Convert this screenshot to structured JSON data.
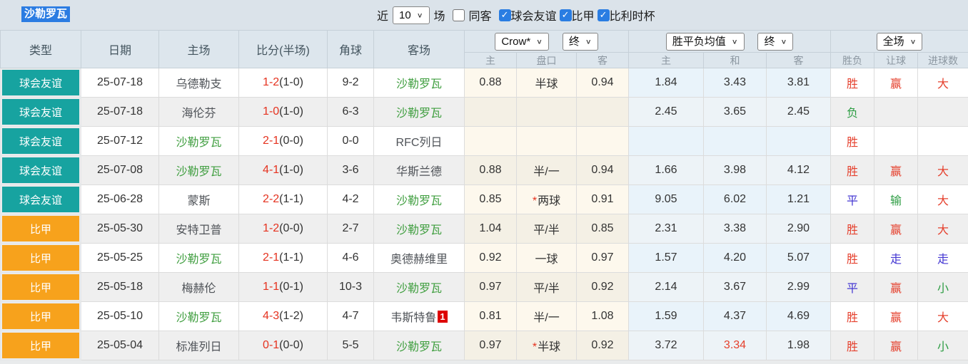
{
  "team_title": "沙勒罗瓦",
  "toolbar": {
    "recent_label": "近",
    "recent_count": "10",
    "matches_label": "场",
    "same_away": {
      "label": "同客",
      "checked": false
    },
    "filters": [
      {
        "label": "球会友谊",
        "checked": true
      },
      {
        "label": "比甲",
        "checked": true
      },
      {
        "label": "比利时杯",
        "checked": true
      }
    ]
  },
  "header": {
    "left_cols": [
      "类型",
      "日期",
      "主场",
      "比分(半场)",
      "角球",
      "客场"
    ],
    "odds_source_select": "Crow*",
    "odds_time_select": "终",
    "avg_select": "胜平负均值",
    "avg_time_select": "终",
    "scope_select": "全场",
    "sub_cols": [
      "主",
      "盘口",
      "客",
      "主",
      "和",
      "客",
      "胜负",
      "让球",
      "进球数"
    ]
  },
  "colors": {
    "friendly_badge": "#17a3a0",
    "league_badge": "#f7a21c",
    "focus_team_green": "#3f9e3f",
    "score_red": "#e5321f",
    "result_red": "#e5402d",
    "result_green": "#2e9d44",
    "result_blue": "#4336d2",
    "title_highlight_blue": "#2b7ce2",
    "checkbox_blue": "#2a7de2"
  },
  "rows": [
    {
      "type": "球会友谊",
      "type_class": "type-friendly",
      "date": "25-07-18",
      "home": "乌德勒支",
      "home_focus": false,
      "score": "1-2",
      "half": "(1-0)",
      "corner": "9-2",
      "away": "沙勒罗瓦",
      "away_focus": true,
      "away_badge": "",
      "odds_home": "0.88",
      "handicap": "半球",
      "handicap_star": false,
      "odds_away": "0.94",
      "avg_home": "1.84",
      "avg_draw": "3.43",
      "avg_draw_red": false,
      "avg_away": "3.81",
      "result": "胜",
      "result_color": "c-red",
      "let_result": "赢",
      "let_color": "c-red",
      "goal_result": "大",
      "goal_color": "c-red"
    },
    {
      "type": "球会友谊",
      "type_class": "type-friendly",
      "date": "25-07-18",
      "home": "海伦芬",
      "home_focus": false,
      "score": "1-0",
      "half": "(1-0)",
      "corner": "6-3",
      "away": "沙勒罗瓦",
      "away_focus": true,
      "away_badge": "",
      "odds_home": "",
      "handicap": "",
      "handicap_star": false,
      "odds_away": "",
      "avg_home": "2.45",
      "avg_draw": "3.65",
      "avg_draw_red": false,
      "avg_away": "2.45",
      "result": "负",
      "result_color": "c-green",
      "let_result": "",
      "let_color": "",
      "goal_result": "",
      "goal_color": ""
    },
    {
      "type": "球会友谊",
      "type_class": "type-friendly",
      "date": "25-07-12",
      "home": "沙勒罗瓦",
      "home_focus": true,
      "score": "2-1",
      "half": "(0-0)",
      "corner": "0-0",
      "away": "RFC列日",
      "away_focus": false,
      "away_badge": "",
      "odds_home": "",
      "handicap": "",
      "handicap_star": false,
      "odds_away": "",
      "avg_home": "",
      "avg_draw": "",
      "avg_draw_red": false,
      "avg_away": "",
      "result": "胜",
      "result_color": "c-red",
      "let_result": "",
      "let_color": "",
      "goal_result": "",
      "goal_color": ""
    },
    {
      "type": "球会友谊",
      "type_class": "type-friendly",
      "date": "25-07-08",
      "home": "沙勒罗瓦",
      "home_focus": true,
      "score": "4-1",
      "half": "(1-0)",
      "corner": "3-6",
      "away": "华斯兰德",
      "away_focus": false,
      "away_badge": "",
      "odds_home": "0.88",
      "handicap": "半/一",
      "handicap_star": false,
      "odds_away": "0.94",
      "avg_home": "1.66",
      "avg_draw": "3.98",
      "avg_draw_red": false,
      "avg_away": "4.12",
      "result": "胜",
      "result_color": "c-red",
      "let_result": "赢",
      "let_color": "c-red",
      "goal_result": "大",
      "goal_color": "c-red"
    },
    {
      "type": "球会友谊",
      "type_class": "type-friendly",
      "date": "25-06-28",
      "home": "蒙斯",
      "home_focus": false,
      "score": "2-2",
      "half": "(1-1)",
      "corner": "4-2",
      "away": "沙勒罗瓦",
      "away_focus": true,
      "away_badge": "",
      "odds_home": "0.85",
      "handicap": "两球",
      "handicap_star": true,
      "odds_away": "0.91",
      "avg_home": "9.05",
      "avg_draw": "6.02",
      "avg_draw_red": false,
      "avg_away": "1.21",
      "result": "平",
      "result_color": "c-blue",
      "let_result": "输",
      "let_color": "c-green",
      "goal_result": "大",
      "goal_color": "c-red"
    },
    {
      "type": "比甲",
      "type_class": "type-league",
      "date": "25-05-30",
      "home": "安特卫普",
      "home_focus": false,
      "score": "1-2",
      "half": "(0-0)",
      "corner": "2-7",
      "away": "沙勒罗瓦",
      "away_focus": true,
      "away_badge": "",
      "odds_home": "1.04",
      "handicap": "平/半",
      "handicap_star": false,
      "odds_away": "0.85",
      "avg_home": "2.31",
      "avg_draw": "3.38",
      "avg_draw_red": false,
      "avg_away": "2.90",
      "result": "胜",
      "result_color": "c-red",
      "let_result": "赢",
      "let_color": "c-red",
      "goal_result": "大",
      "goal_color": "c-red"
    },
    {
      "type": "比甲",
      "type_class": "type-league",
      "date": "25-05-25",
      "home": "沙勒罗瓦",
      "home_focus": true,
      "score": "2-1",
      "half": "(1-1)",
      "corner": "4-6",
      "away": "奥德赫维里",
      "away_focus": false,
      "away_badge": "",
      "odds_home": "0.92",
      "handicap": "一球",
      "handicap_star": false,
      "odds_away": "0.97",
      "avg_home": "1.57",
      "avg_draw": "4.20",
      "avg_draw_red": false,
      "avg_away": "5.07",
      "result": "胜",
      "result_color": "c-red",
      "let_result": "走",
      "let_color": "c-blue",
      "goal_result": "走",
      "goal_color": "c-blue"
    },
    {
      "type": "比甲",
      "type_class": "type-league",
      "date": "25-05-18",
      "home": "梅赫伦",
      "home_focus": false,
      "score": "1-1",
      "half": "(0-1)",
      "corner": "10-3",
      "away": "沙勒罗瓦",
      "away_focus": true,
      "away_badge": "",
      "odds_home": "0.97",
      "handicap": "平/半",
      "handicap_star": false,
      "odds_away": "0.92",
      "avg_home": "2.14",
      "avg_draw": "3.67",
      "avg_draw_red": false,
      "avg_away": "2.99",
      "result": "平",
      "result_color": "c-blue",
      "let_result": "赢",
      "let_color": "c-red",
      "goal_result": "小",
      "goal_color": "c-green"
    },
    {
      "type": "比甲",
      "type_class": "type-league",
      "date": "25-05-10",
      "home": "沙勒罗瓦",
      "home_focus": true,
      "score": "4-3",
      "half": "(1-2)",
      "corner": "4-7",
      "away": "韦斯特鲁",
      "away_focus": false,
      "away_badge": "1",
      "odds_home": "0.81",
      "handicap": "半/一",
      "handicap_star": false,
      "odds_away": "1.08",
      "avg_home": "1.59",
      "avg_draw": "4.37",
      "avg_draw_red": false,
      "avg_away": "4.69",
      "result": "胜",
      "result_color": "c-red",
      "let_result": "赢",
      "let_color": "c-red",
      "goal_result": "大",
      "goal_color": "c-red"
    },
    {
      "type": "比甲",
      "type_class": "type-league",
      "date": "25-05-04",
      "home": "标准列日",
      "home_focus": false,
      "score": "0-1",
      "half": "(0-0)",
      "corner": "5-5",
      "away": "沙勒罗瓦",
      "away_focus": true,
      "away_badge": "",
      "odds_home": "0.97",
      "handicap": "半球",
      "handicap_star": true,
      "odds_away": "0.92",
      "avg_home": "3.72",
      "avg_draw": "3.34",
      "avg_draw_red": true,
      "avg_away": "1.98",
      "result": "胜",
      "result_color": "c-red",
      "let_result": "赢",
      "let_color": "c-red",
      "goal_result": "小",
      "goal_color": "c-green"
    }
  ]
}
